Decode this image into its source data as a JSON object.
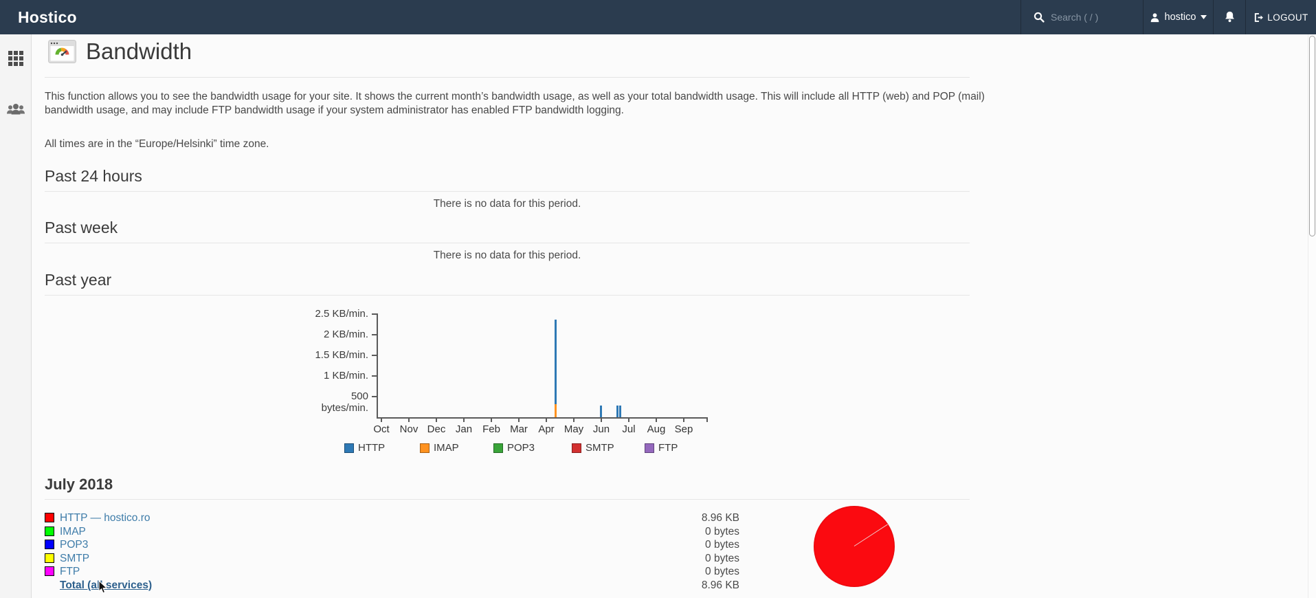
{
  "topbar": {
    "brand": "Hostico",
    "search_placeholder": "Search ( / )",
    "username": "hostico",
    "logout_label": "LOGOUT"
  },
  "page": {
    "title": "Bandwidth",
    "description": "This function allows you to see the bandwidth usage for your site. It shows the current month’s bandwidth usage, as well as your total bandwidth usage. This will include all HTTP (web) and POP (mail) bandwidth usage, and may include FTP bandwidth usage if your system administrator has enabled FTP bandwidth logging.",
    "timezone_note": "All times are in the “Europe/Helsinki” time zone."
  },
  "sections": {
    "past_24_hours": {
      "title": "Past 24 hours",
      "empty_message": "There is no data for this period."
    },
    "past_week": {
      "title": "Past week",
      "empty_message": "There is no data for this period."
    },
    "past_year": {
      "title": "Past year"
    },
    "month_detail": {
      "title": "July 2018"
    }
  },
  "chart_data": {
    "type": "bar",
    "title": "Past year",
    "categories": [
      "Oct",
      "Nov",
      "Dec",
      "Jan",
      "Feb",
      "Mar",
      "Apr",
      "May",
      "Jun",
      "Jul",
      "Aug",
      "Sep"
    ],
    "unit": "bytes/min",
    "ylim_bytes_per_min": [
      0,
      2500
    ],
    "y_ticks": [
      {
        "label": "2.5 KB/min.",
        "bytes_per_min": 2500
      },
      {
        "label": "2 KB/min.",
        "bytes_per_min": 2000
      },
      {
        "label": "1.5 KB/min.",
        "bytes_per_min": 1500
      },
      {
        "label": "1 KB/min.",
        "bytes_per_min": 1000
      },
      {
        "label": "500 bytes/min.",
        "bytes_per_min": 500
      }
    ],
    "legend_position": "bottom",
    "grid": false,
    "legend": [
      {
        "name": "HTTP",
        "color": "#2e79b5"
      },
      {
        "name": "IMAP",
        "color": "#ff9220"
      },
      {
        "name": "POP3",
        "color": "#39a439"
      },
      {
        "name": "SMTP",
        "color": "#d23030"
      },
      {
        "name": "FTP",
        "color": "#9468bd"
      }
    ],
    "spikes": [
      {
        "x_month": "mid-Apr",
        "x_frac": 0.542,
        "stack": [
          {
            "name": "IMAP",
            "bytes_per_min": 320
          },
          {
            "name": "HTTP",
            "bytes_per_min": 2050
          }
        ]
      },
      {
        "x_month": "Jun",
        "x_frac": 0.679,
        "stack": [
          {
            "name": "HTTP",
            "bytes_per_min": 280
          }
        ]
      },
      {
        "x_month": "late-Jun",
        "x_frac": 0.729,
        "stack": [
          {
            "name": "HTTP",
            "bytes_per_min": 280
          }
        ]
      },
      {
        "x_month": "late-Jun",
        "x_frac": 0.737,
        "stack": [
          {
            "name": "HTTP",
            "bytes_per_min": 280
          }
        ]
      }
    ]
  },
  "month_table": {
    "rows": [
      {
        "swatch": "#ff0000",
        "label": "HTTP — hostico.ro",
        "value": "8.96 KB",
        "is_total": false
      },
      {
        "swatch": "#00ff00",
        "label": "IMAP",
        "value": "0 bytes",
        "is_total": false
      },
      {
        "swatch": "#0000ff",
        "label": "POP3",
        "value": "0 bytes",
        "is_total": false
      },
      {
        "swatch": "#ffff00",
        "label": "SMTP",
        "value": "0 bytes",
        "is_total": false
      },
      {
        "swatch": "#ff00ff",
        "label": "FTP",
        "value": "0 bytes",
        "is_total": false
      },
      {
        "swatch": null,
        "label": "Total (all services)",
        "value": "8.96 KB",
        "is_total": true
      }
    ],
    "pie": {
      "type": "pie",
      "slices": [
        {
          "label": "HTTP",
          "fraction": 1.0,
          "color": "#fb0a10"
        }
      ]
    }
  }
}
